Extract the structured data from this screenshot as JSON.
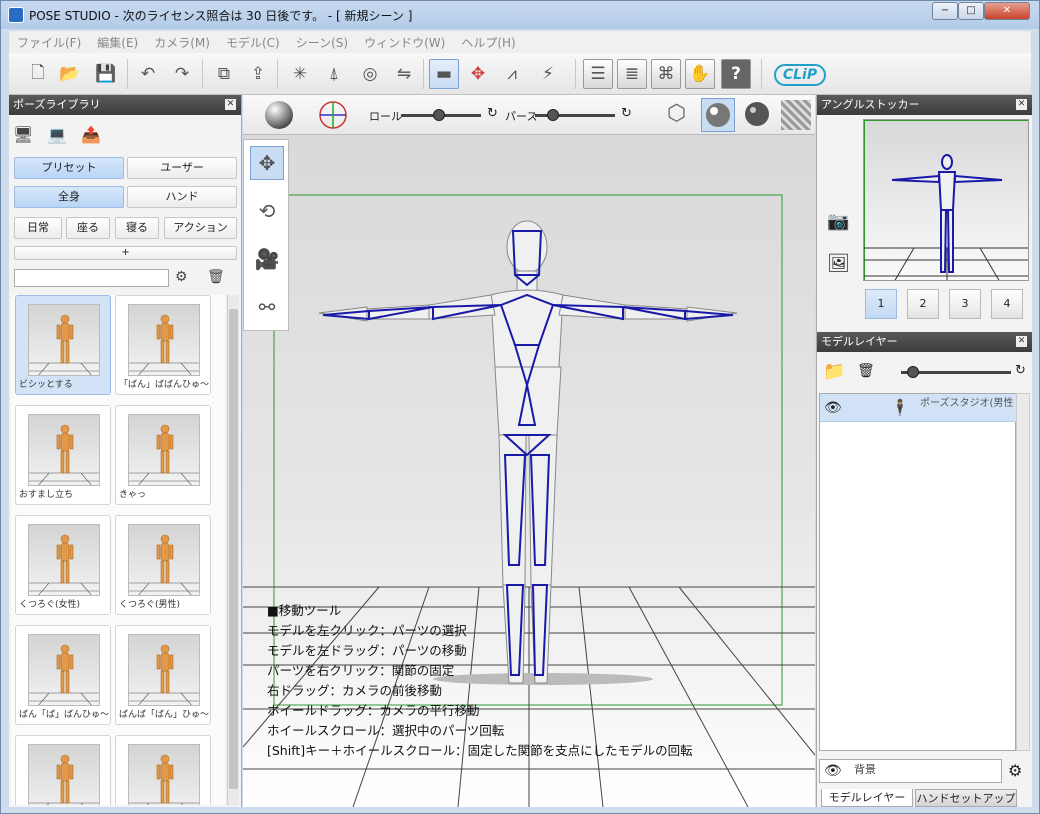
{
  "window": {
    "title": "POSE STUDIO  - 次のライセンス照合は 30 日後です。 - [ 新規シーン ]",
    "controls": [
      "−",
      "□",
      "✕"
    ]
  },
  "menu": [
    "ファイル(F)",
    "編集(E)",
    "カメラ(M)",
    "モデル(C)",
    "シーン(S)",
    "ウィンドウ(W)",
    "ヘルプ(H)"
  ],
  "toolbar": {
    "logo": "CLiP",
    "help_label": "?"
  },
  "pose_library": {
    "title": "ポーズライブラリ",
    "tabs": [
      "プリセット",
      "ユーザー"
    ],
    "scopes": [
      "全身",
      "ハンド"
    ],
    "categories": [
      "日常",
      "座る",
      "寝る",
      "アクション"
    ],
    "add_label": "+",
    "search_value": "",
    "poses": [
      {
        "label": "ビシッとする",
        "selected": true
      },
      {
        "label": "「ばん」ばばんひゅ～",
        "selected": false
      },
      {
        "label": "おすまし立ち",
        "selected": false
      },
      {
        "label": "きゃっ",
        "selected": false
      },
      {
        "label": "くつろぐ(女性)",
        "selected": false
      },
      {
        "label": "くつろぐ(男性)",
        "selected": false
      },
      {
        "label": "ばん「ば」ばんひゅ～",
        "selected": false
      },
      {
        "label": "ばんば「ばん」ひゅ～",
        "selected": false
      },
      {
        "label": "",
        "selected": false
      },
      {
        "label": "",
        "selected": false
      }
    ]
  },
  "viewport": {
    "roll_label": "ロール",
    "perspective_label": "パース",
    "help_lines": [
      "■移動ツール",
      "モデルを左クリック：パーツの選択",
      "モデルを左ドラッグ：パーツの移動",
      "パーツを右クリック：関節の固定",
      "右ドラッグ：カメラの前後移動",
      "ホイールドラッグ：カメラの平行移動",
      "ホイールスクロール：選択中のパーツ回転",
      "[Shift]キー＋ホイールスクロール：固定した関節を支点にしたモデルの回転"
    ]
  },
  "angle_stocker": {
    "title": "アングルストッカー",
    "slots": [
      "1",
      "2",
      "3",
      "4"
    ]
  },
  "model_layer": {
    "title": "モデルレイヤー",
    "layer_name": "ポーズスタジオ(男性",
    "background_label": "背景",
    "bottom_tabs": [
      "モデルレイヤー",
      "ハンドセットアップ"
    ]
  }
}
